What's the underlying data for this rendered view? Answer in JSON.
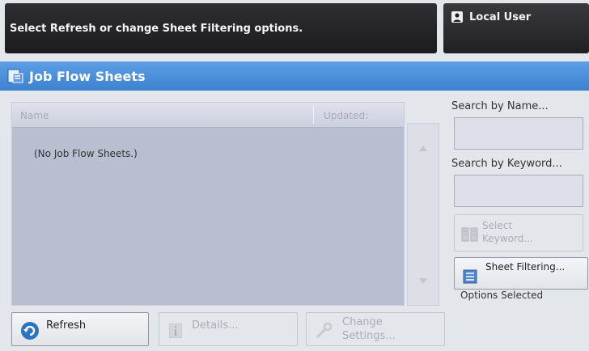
{
  "header": {
    "message": "Select Refresh or change Sheet Filtering options.",
    "user_label": "Local User"
  },
  "window": {
    "title": "Job Flow Sheets"
  },
  "list": {
    "columns": [
      "Name",
      "Updated:"
    ],
    "empty_message": "(No Job Flow Sheets.)"
  },
  "search": {
    "by_name_label": "Search by Name...",
    "by_keyword_label": "Search by Keyword..."
  },
  "buttons": {
    "select_keyword_line1": "Select",
    "select_keyword_line2": "Keyword...",
    "sheet_filtering": "Sheet Filtering...",
    "options_selected": "Options Selected",
    "refresh": "Refresh",
    "details": "Details...",
    "change_settings_line1": "Change",
    "change_settings_line2": "Settings..."
  },
  "colors": {
    "title_bar": "#4a8fdb",
    "list_background": "#b9bed0"
  }
}
